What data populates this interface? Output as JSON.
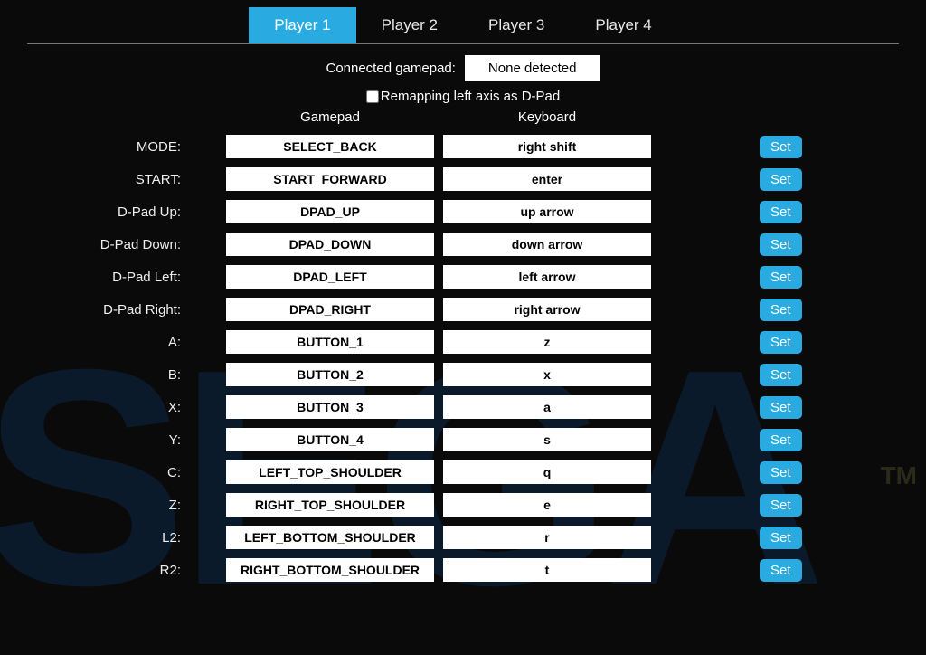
{
  "tabs": [
    {
      "label": "Player 1",
      "active": true
    },
    {
      "label": "Player 2",
      "active": false
    },
    {
      "label": "Player 3",
      "active": false
    },
    {
      "label": "Player 4",
      "active": false
    }
  ],
  "connected": {
    "label": "Connected gamepad:",
    "value": "None detected"
  },
  "remap": {
    "label": "Remapping left axis as D-Pad",
    "checked": false
  },
  "columns": {
    "gamepad": "Gamepad",
    "keyboard": "Keyboard"
  },
  "set_label": "Set",
  "bindings": [
    {
      "label": "MODE:",
      "gamepad": "SELECT_BACK",
      "keyboard": "right shift"
    },
    {
      "label": "START:",
      "gamepad": "START_FORWARD",
      "keyboard": "enter"
    },
    {
      "label": "D-Pad Up:",
      "gamepad": "DPAD_UP",
      "keyboard": "up arrow"
    },
    {
      "label": "D-Pad Down:",
      "gamepad": "DPAD_DOWN",
      "keyboard": "down arrow"
    },
    {
      "label": "D-Pad Left:",
      "gamepad": "DPAD_LEFT",
      "keyboard": "left arrow"
    },
    {
      "label": "D-Pad Right:",
      "gamepad": "DPAD_RIGHT",
      "keyboard": "right arrow"
    },
    {
      "label": "A:",
      "gamepad": "BUTTON_1",
      "keyboard": "z"
    },
    {
      "label": "B:",
      "gamepad": "BUTTON_2",
      "keyboard": "x"
    },
    {
      "label": "X:",
      "gamepad": "BUTTON_3",
      "keyboard": "a"
    },
    {
      "label": "Y:",
      "gamepad": "BUTTON_4",
      "keyboard": "s"
    },
    {
      "label": "C:",
      "gamepad": "LEFT_TOP_SHOULDER",
      "keyboard": "q"
    },
    {
      "label": "Z:",
      "gamepad": "RIGHT_TOP_SHOULDER",
      "keyboard": "e"
    },
    {
      "label": "L2:",
      "gamepad": "LEFT_BOTTOM_SHOULDER",
      "keyboard": "r"
    },
    {
      "label": "R2:",
      "gamepad": "RIGHT_BOTTOM_SHOULDER",
      "keyboard": "t"
    }
  ]
}
